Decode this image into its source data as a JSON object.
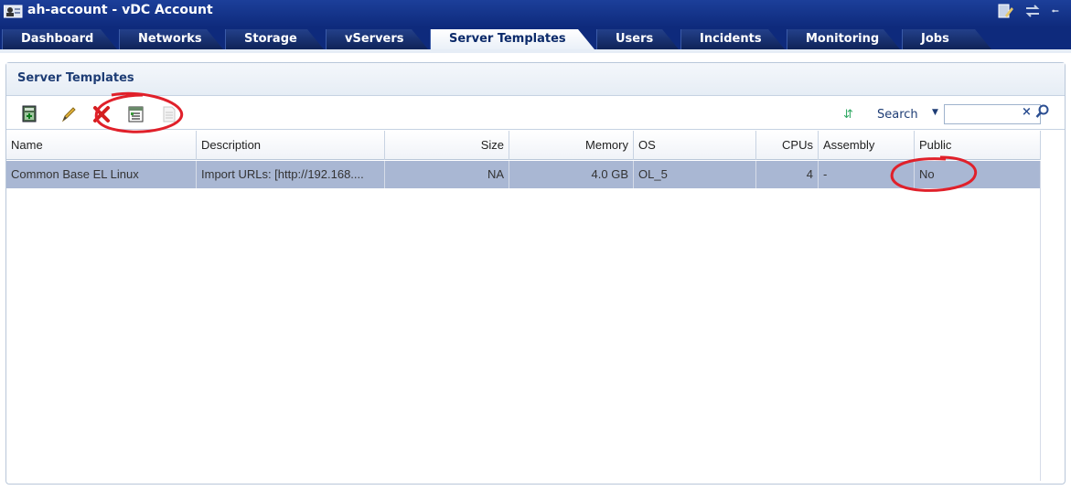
{
  "window": {
    "title": "ah-account - vDC Account"
  },
  "tabs": [
    {
      "label": "Dashboard",
      "active": false
    },
    {
      "label": "Networks",
      "active": false
    },
    {
      "label": "Storage",
      "active": false
    },
    {
      "label": "vServers",
      "active": false
    },
    {
      "label": "Server Templates",
      "active": true
    },
    {
      "label": "Users",
      "active": false
    },
    {
      "label": "Incidents",
      "active": false
    },
    {
      "label": "Monitoring",
      "active": false
    },
    {
      "label": "Jobs",
      "active": false
    }
  ],
  "panel": {
    "title": "Server Templates"
  },
  "toolbar": {
    "icons": [
      "register-template-icon",
      "edit-icon",
      "delete-icon",
      "properties-icon",
      "document-icon"
    ],
    "search_label": "Search",
    "search_value": ""
  },
  "table": {
    "columns": [
      "Name",
      "Description",
      "Size",
      "Memory",
      "OS",
      "CPUs",
      "Assembly",
      "Public"
    ],
    "rows": [
      {
        "name": "Common Base EL Linux",
        "description": "Import URLs: [http://192.168....",
        "size": "NA",
        "memory": "4.0 GB",
        "os": "OL_5",
        "cpus": "4",
        "assembly": "-",
        "public": "No"
      }
    ]
  },
  "colors": {
    "titlebar": "#0e2a7c",
    "selected_row": "#a9b7d3",
    "annotation": "#e0202a"
  }
}
